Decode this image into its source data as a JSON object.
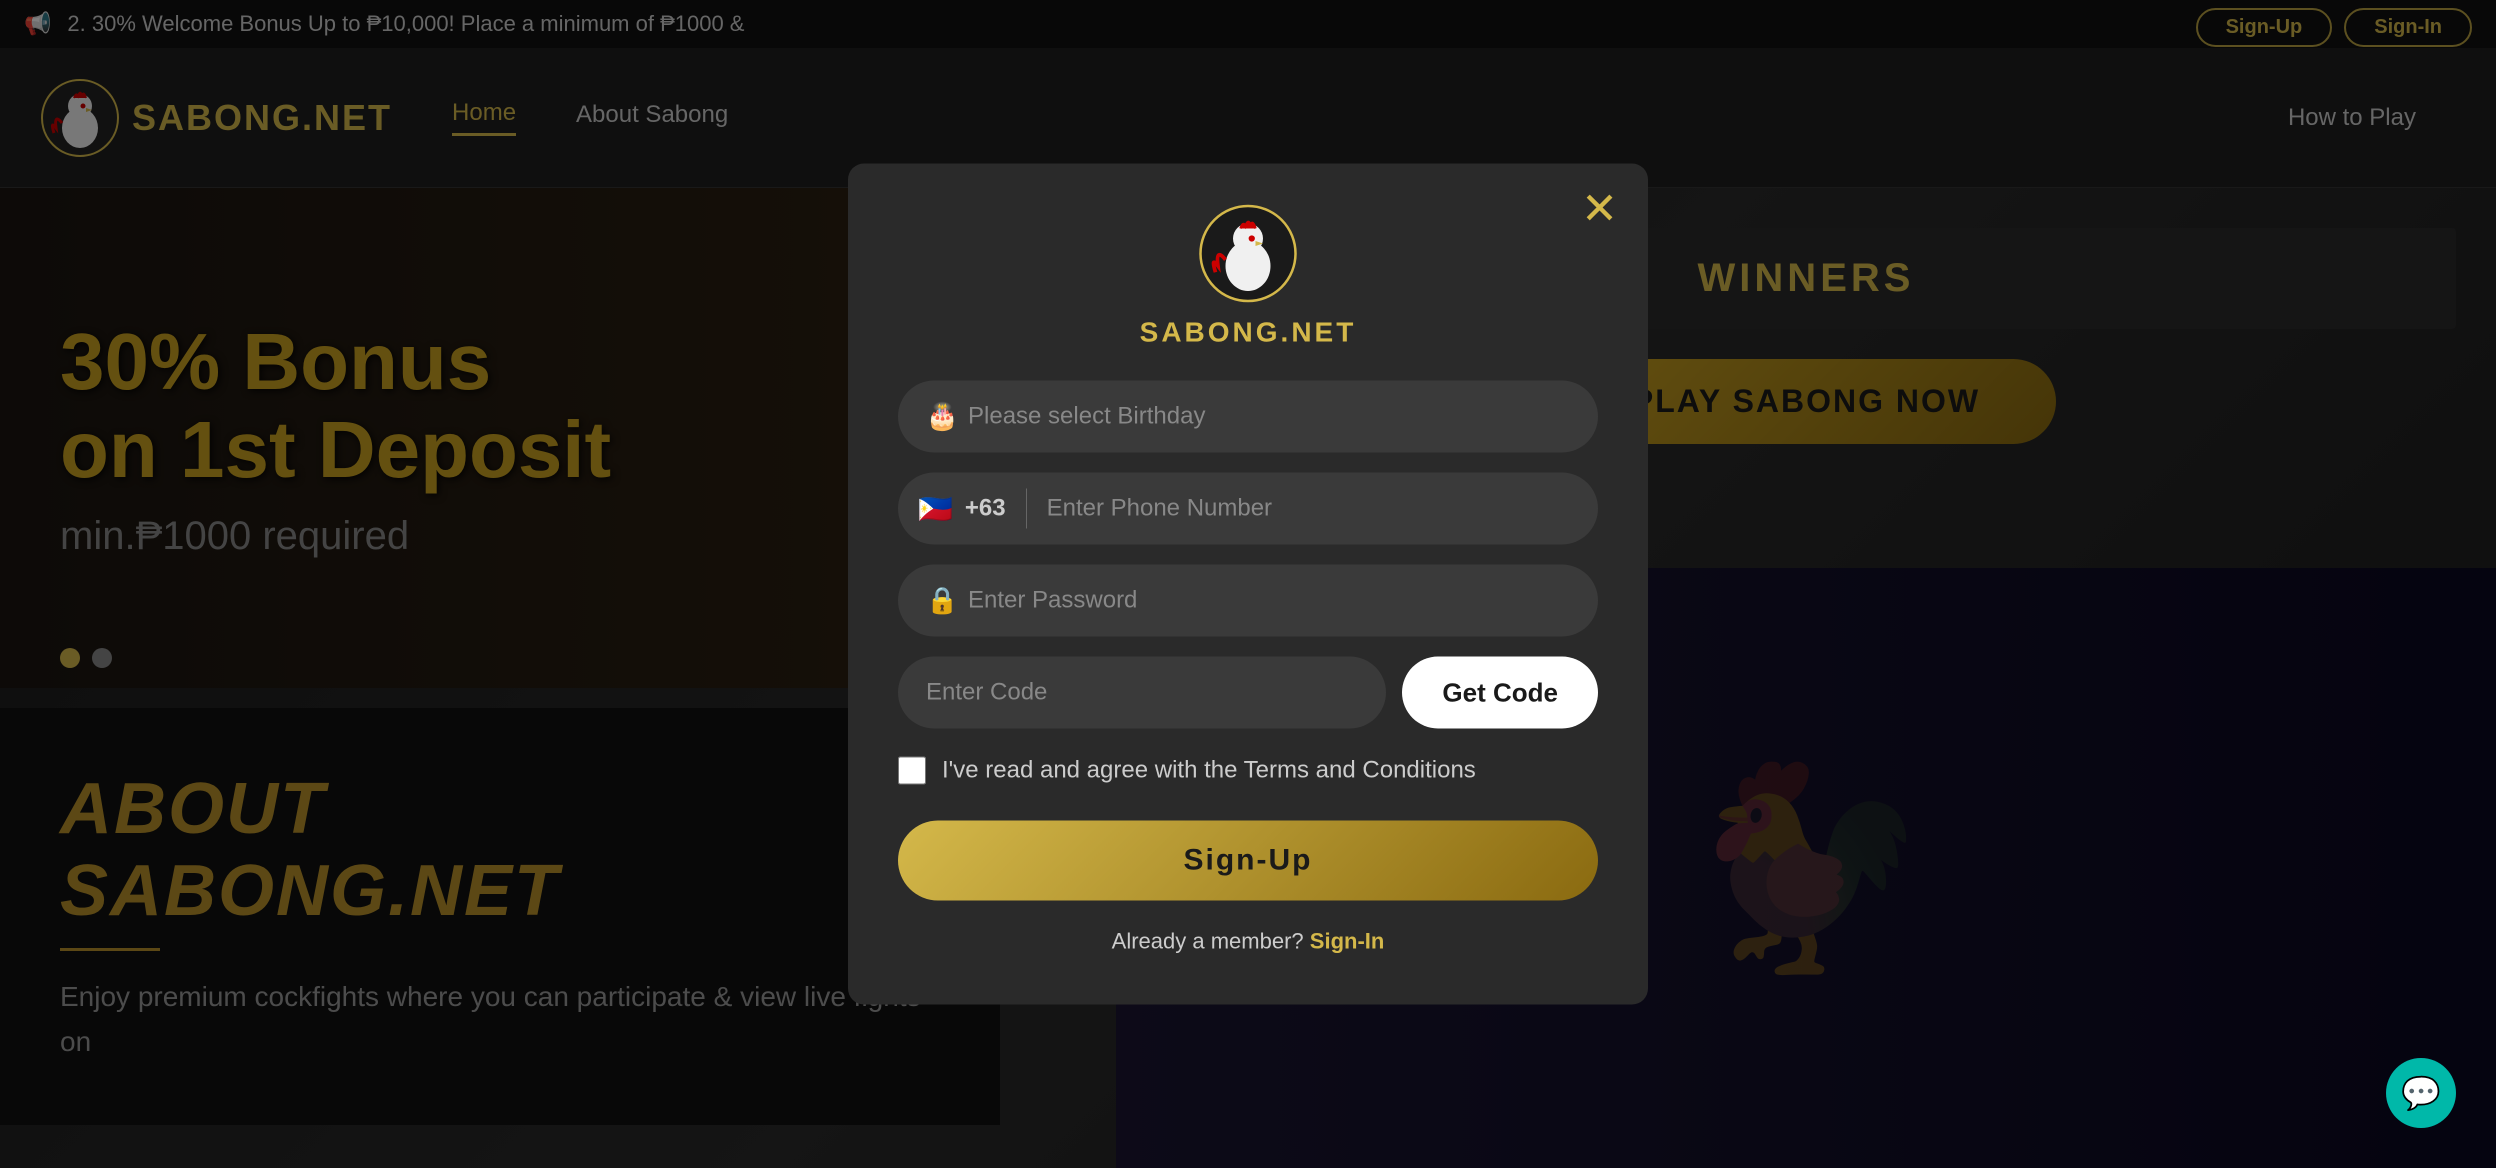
{
  "announcement": {
    "icon": "📢",
    "text": "2. 30% Welcome Bonus Up to ₱10,000! Place a minimum of ₱1000 &"
  },
  "topbar": {
    "signup_label": "Sign-Up",
    "signin_label": "Sign-In"
  },
  "header": {
    "logo_text": "SABONG.NET",
    "nav": [
      {
        "label": "Home",
        "active": true
      },
      {
        "label": "About Sabong",
        "active": false
      },
      {
        "label": "How to Play",
        "active": false
      }
    ]
  },
  "hero": {
    "title_line1": "30% Bonus",
    "title_line2": "on 1st Deposit",
    "subtitle": "min.₱1000 required"
  },
  "about": {
    "title": "ABOUT",
    "title2": "SABONG.NET",
    "description": "Enjoy premium cockfights where you\ncan participate & view live fights on"
  },
  "winners": {
    "title": "WINNERS"
  },
  "play_button": {
    "label": "PLAY SABONG NOW"
  },
  "modal": {
    "logo_text": "SABONG.NET",
    "close_label": "✕",
    "birthday_placeholder": "Please select Birthday",
    "phone_flag": "🇵🇭",
    "phone_code": "+63",
    "phone_placeholder": "Enter Phone Number",
    "password_placeholder": "Enter Password",
    "code_placeholder": "Enter Code",
    "get_code_label": "Get Code",
    "terms_text": "I've read and agree with the Terms and Conditions",
    "signup_label": "Sign-Up",
    "already_text": "Already a member?",
    "signin_label": "Sign-In"
  },
  "chat": {
    "icon": "💬"
  }
}
